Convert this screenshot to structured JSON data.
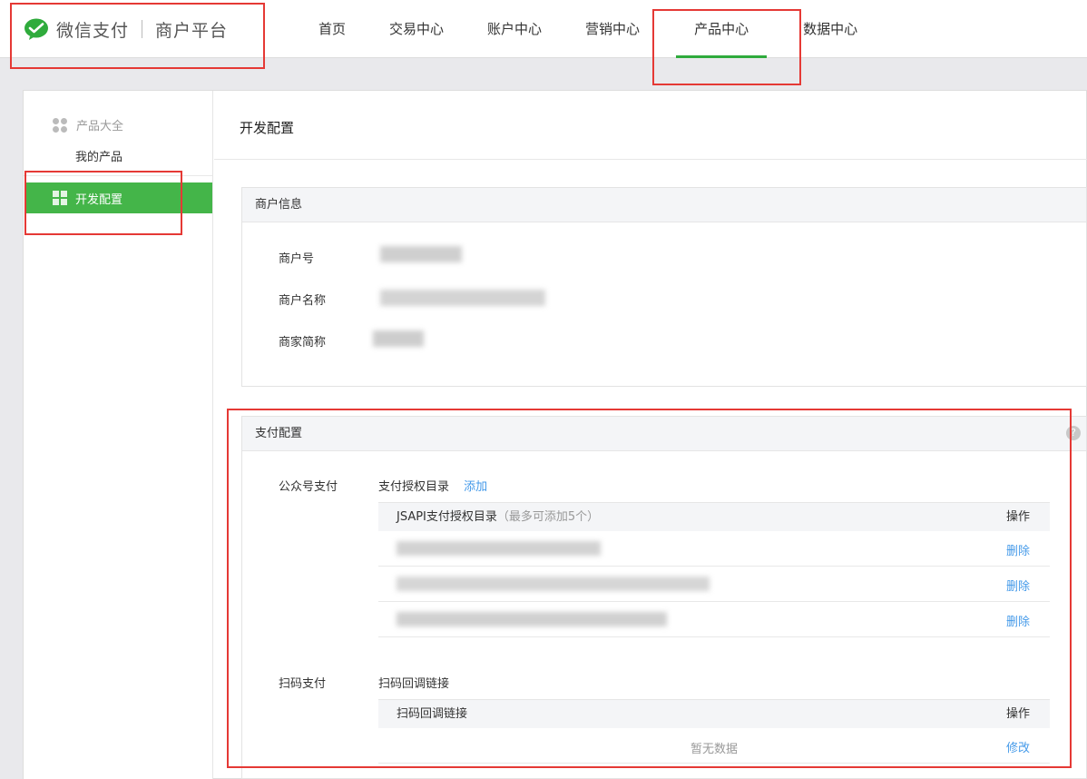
{
  "app": {
    "brand": "微信支付",
    "platform": "商户平台"
  },
  "nav": {
    "items": [
      {
        "label": "首页"
      },
      {
        "label": "交易中心"
      },
      {
        "label": "账户中心"
      },
      {
        "label": "营销中心"
      },
      {
        "label": "产品中心",
        "active": true
      },
      {
        "label": "数据中心"
      }
    ]
  },
  "sidebar": {
    "group_label": "产品大全",
    "sub_item": "我的产品",
    "active_item": "开发配置"
  },
  "page": {
    "title": "开发配置"
  },
  "merchant_info": {
    "title": "商户信息",
    "fields": [
      {
        "label": "商户号"
      },
      {
        "label": "商户名称"
      },
      {
        "label": "商家简称"
      }
    ]
  },
  "pay_config": {
    "title": "支付配置",
    "help_icon": "?",
    "jsapi": {
      "section_label": "公众号支付",
      "dir_label": "支付授权目录",
      "add_label": "添加",
      "table_header": "JSAPI支付授权目录",
      "table_header_note": "（最多可添加5个）",
      "action_header": "操作",
      "rows": [
        {
          "action": "删除"
        },
        {
          "action": "删除"
        },
        {
          "action": "删除"
        }
      ]
    },
    "native": {
      "section_label": "扫码支付",
      "callback_label": "扫码回调链接",
      "table_header": "扫码回调链接",
      "action_header": "操作",
      "empty_text": "暂无数据",
      "action": "修改"
    }
  },
  "colors": {
    "brand_green": "#44b549",
    "link_blue": "#459ae9",
    "annotation_red": "#e53935"
  }
}
